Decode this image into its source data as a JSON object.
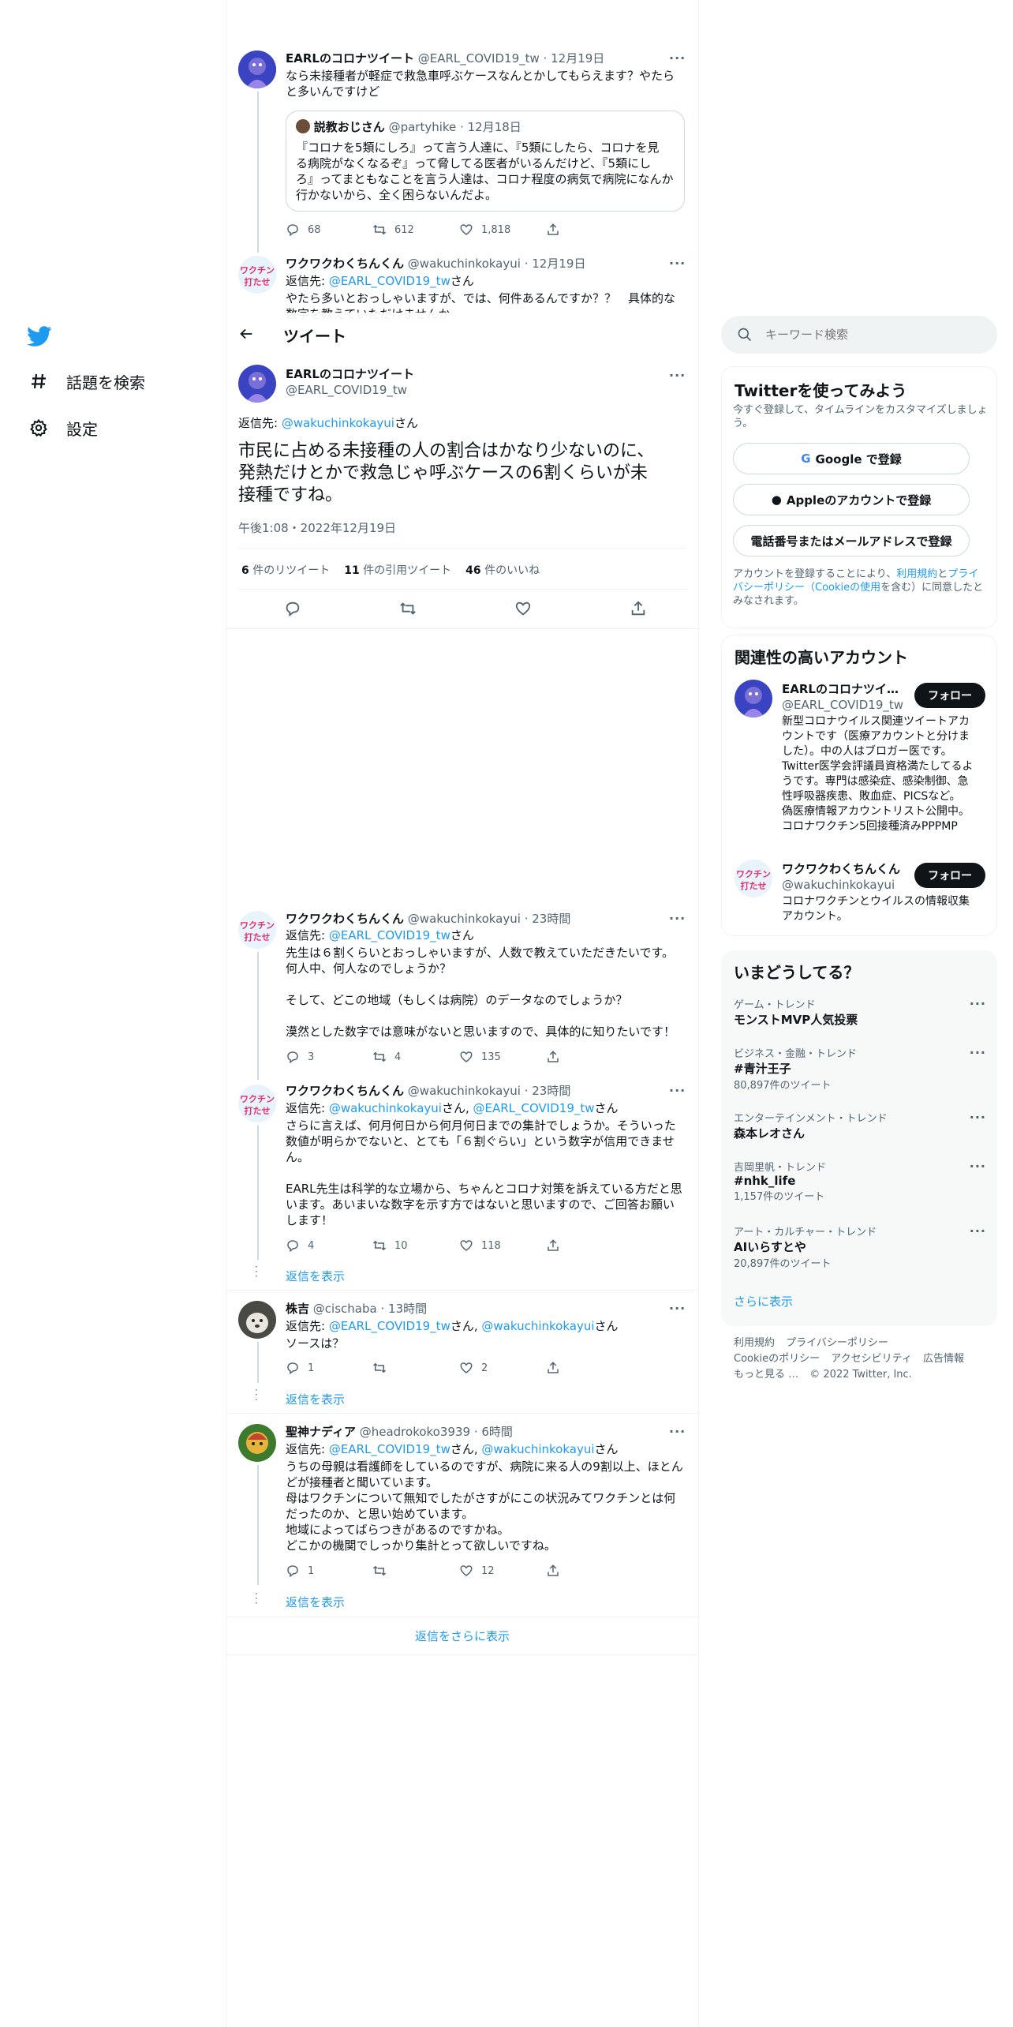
{
  "nav": {
    "explore": "話題を検索",
    "settings": "設定"
  },
  "thread_above": {
    "t1": {
      "name": "EARLのコロナツイート",
      "handle": "@EARL_COVID19_tw",
      "date": "12月19日",
      "text1": "なら未接種者が軽症で救急車呼ぶケースなんとかしてもらえます？やたら",
      "text2": "と多いんですけど",
      "quote": {
        "name": "説教おじさん",
        "handle": "@partyhike",
        "date": "12月18日",
        "l1": "『コロナを5類にしろ』って言う人達に、『5類にしたら、コロナを見",
        "l2": "る病院がなくなるぞ』って脅してる医者がいるんだけど、『5類にし",
        "l3": "ろ』ってまともなことを言う人達は、コロナ程度の病気で病院になんか",
        "l4": "行かないから、全く困らないんだよ。"
      },
      "replies": "68",
      "retweets": "612",
      "likes": "1,818"
    },
    "t2": {
      "name": "ワクワクわくちんくん",
      "handle": "@wakuchinkokayui",
      "date": "12月19日",
      "reply_prefix": "返信先: ",
      "reply_to": "@EARL_COVID19_tw",
      "reply_suffix": "さん",
      "text1": "やたら多いとおっしゃいますが、では、何件あるんですか？？　具体的な",
      "text2": "数字を教えていただけませんか"
    }
  },
  "header": {
    "title": "ツイート"
  },
  "main": {
    "name": "EARLのコロナツイート",
    "handle": "@EARL_COVID19_tw",
    "reply_prefix": "返信先: ",
    "reply_to": "@wakuchinkokayui",
    "reply_suffix": "さん",
    "text1": "市民に占める未接種の人の割合はかなり少ないのに、",
    "text2": "発熱だけとかで救急じゃ呼ぶケースの6割くらいが未",
    "text3": "接種ですね。",
    "timestamp": "午後1:08・2022年12月19日",
    "retweet_count": "6",
    "retweet_label": "件のリツイート",
    "quote_count": "11",
    "quote_label": "件の引用ツイート",
    "like_count": "46",
    "like_label": "件のいいね"
  },
  "replies": {
    "r1": {
      "name": "ワクワクわくちんくん",
      "handle": "@wakuchinkokayui",
      "time": "23時間",
      "reply_prefix": "返信先: ",
      "reply_to": "@EARL_COVID19_tw",
      "reply_suffix": "さん",
      "l1": "先生は６割くらいとおっしゃいますが、人数で教えていただきたいです。",
      "l2": "何人中、何人なのでしょうか？",
      "l3": "そして、どこの地域（もしくは病院）のデータなのでしょうか？",
      "l4": "漠然とした数字では意味がないと思いますので、具体的に知りたいです！",
      "replies": "3",
      "retweets": "4",
      "likes": "135"
    },
    "r2": {
      "name": "ワクワクわくちんくん",
      "handle": "@wakuchinkokayui",
      "time": "23時間",
      "reply_prefix": "返信先: ",
      "reply_to1": "@wakuchinkokayui",
      "reply_mid": "さん, ",
      "reply_to2": "@EARL_COVID19_tw",
      "reply_suffix": "さん",
      "l1": "さらに言えば、何月何日から何月何日までの集計でしょうか。そういった",
      "l2": "数値が明らかでないと、とても「６割ぐらい」という数字が信用できませ",
      "l3": "ん。",
      "l4": "EARL先生は科学的な立場から、ちゃんとコロナ対策を訴えている方だと思",
      "l5": "います。あいまいな数字を示す方ではないと思いますので、ご回答お願い",
      "l6": "します！",
      "replies": "4",
      "retweets": "10",
      "likes": "118",
      "show_replies": "返信を表示"
    },
    "r3": {
      "name": "株吉",
      "handle": "@cischaba",
      "time": "13時間",
      "reply_prefix": "返信先: ",
      "reply_to1": "@EARL_COVID19_tw",
      "reply_mid": "さん, ",
      "reply_to2": "@wakuchinkokayui",
      "reply_suffix": "さん",
      "l1": "ソースは？",
      "replies": "1",
      "likes": "2",
      "show_replies": "返信を表示"
    },
    "r4": {
      "name": "聖神ナディア",
      "handle": "@headrokoko3939",
      "time": "6時間",
      "reply_prefix": "返信先: ",
      "reply_to1": "@EARL_COVID19_tw",
      "reply_mid": "さん, ",
      "reply_to2": "@wakuchinkokayui",
      "reply_suffix": "さん",
      "l1": "うちの母親は看護師をしているのですが、病院に来る人の9割以上、ほとん",
      "l2": "どが接種者と聞いています。",
      "l3": "母はワクチンについて無知でしたがさすがにこの状況みてワクチンとは何",
      "l4": "だったのか、と思い始めています。",
      "l5": "地域によってばらつきがあるのですかね。",
      "l6": "どこかの機関でしっかり集計とって欲しいですね。",
      "replies": "1",
      "likes": "12",
      "show_replies": "返信を表示"
    },
    "more": "返信をさらに表示"
  },
  "search": {
    "placeholder": "キーワード検索"
  },
  "signup": {
    "title": "Twitterを使ってみよう",
    "sub1": "今すぐ登録して、タイムラインをカスタマイズしましょ",
    "sub2": "う。",
    "google": "Google で登録",
    "apple": "Appleのアカウントで登録",
    "phone": "電話番号またはメールアドレスで登録",
    "terms_a": "アカウントを登録することにより、",
    "terms_link1": "利用規約",
    "terms_b": "と",
    "terms_link2": "プライ",
    "terms_link3": "バシーポリシー（Cookieの使用",
    "terms_c": "を含む）に同意したと",
    "terms_d": "みなされます。"
  },
  "related": {
    "title": "関連性の高いアカウント",
    "a1": {
      "name": "EARLのコロナツイ…",
      "handle": "@EARL_COVID19_tw",
      "follow": "フォロー",
      "b1": "新型コロナウイルス関連ツイートアカ",
      "b2": "ウントです（医療アカウントと分けま",
      "b3": "した）。中の人はブロガー医です。",
      "b4": "Twitter医学会評議員資格満たしてるよ",
      "b5": "うです。専門は感染症、感染制御、急",
      "b6": "性呼吸器疾患、敗血症、PICSなど。",
      "b7": "偽医療情報アカウントリスト公開中。",
      "b8": "コロナワクチン5回接種済みPPPMP"
    },
    "a2": {
      "name": "ワクワクわくちんくん",
      "handle": "@wakuchinkokayui",
      "follow": "フォロー",
      "b1": "コロナワクチンとウイルスの情報収集",
      "b2": "アカウント。"
    }
  },
  "trends": {
    "title": "いまどうしてる？",
    "items": [
      {
        "meta": "ゲーム・トレンド",
        "name": "モンストMVP人気投票",
        "count": ""
      },
      {
        "meta": "ビジネス・金融・トレンド",
        "name": "#青汁王子",
        "count": "80,897件のツイート"
      },
      {
        "meta": "エンターテインメント・トレンド",
        "name": "森本レオさん",
        "count": ""
      },
      {
        "meta": "吉岡里帆・トレンド",
        "name": "#nhk_life",
        "count": "1,157件のツイート"
      },
      {
        "meta": "アート・カルチャー・トレンド",
        "name": "AIいらすとや",
        "count": "20,897件のツイート"
      }
    ],
    "more": "さらに表示"
  },
  "footer": {
    "terms": "利用規約",
    "privacy": "プライバシーポリシー",
    "cookie": "Cookieのポリシー",
    "a11y": "アクセシビリティ",
    "ads": "広告情報",
    "more": "もっと見る …",
    "copy": "© 2022 Twitter, Inc."
  },
  "colors": {
    "accent": "#1d9bf0",
    "text": "#0f1419",
    "muted": "#536471"
  }
}
